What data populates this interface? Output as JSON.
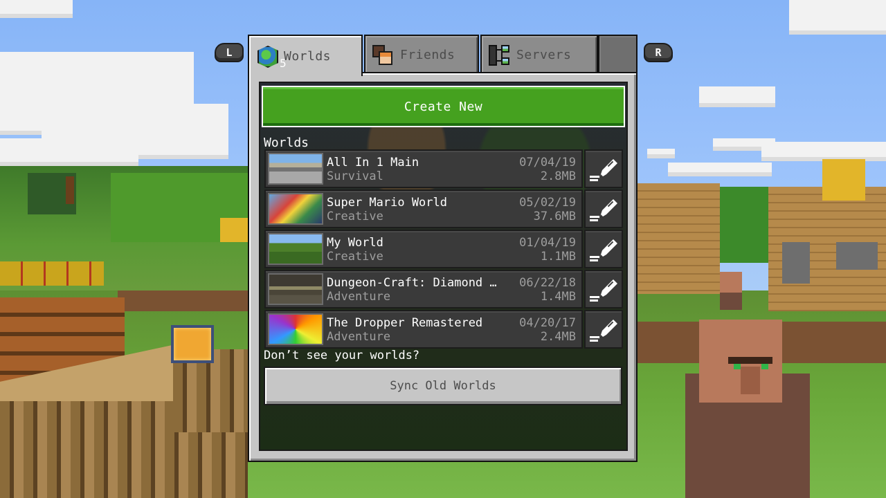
{
  "controls": {
    "left_shoulder": "L",
    "right_shoulder": "R"
  },
  "tabs": [
    {
      "label": "Worlds",
      "icon": "globe-icon",
      "badge": "5",
      "active": true
    },
    {
      "label": "Friends",
      "icon": "friends-faces-icon",
      "active": false
    },
    {
      "label": "Servers",
      "icon": "server-icon",
      "active": false
    }
  ],
  "main": {
    "create_button": "Create New",
    "section_label": "Worlds",
    "worlds": [
      {
        "name": "All In 1 Main",
        "mode": "Survival",
        "date": "07/04/19",
        "size": "2.8MB"
      },
      {
        "name": "Super Mario World",
        "mode": "Creative",
        "date": "05/02/19",
        "size": "37.6MB"
      },
      {
        "name": "My World",
        "mode": "Creative",
        "date": "01/04/19",
        "size": "1.1MB"
      },
      {
        "name": "Dungeon-Craft: Diamond …",
        "mode": "Adventure",
        "date": "06/22/18",
        "size": "1.4MB"
      },
      {
        "name": "The Dropper Remastered",
        "mode": "Adventure",
        "date": "04/20/17",
        "size": "2.4MB"
      }
    ],
    "hint": "Don’t see your worlds?",
    "sync_button": "Sync Old Worlds"
  },
  "colors": {
    "create_green": "#45a11f",
    "panel_gray": "#c6c6c6",
    "row_dark": "#3a3a3a",
    "sky_blue": "#8fb8f6"
  }
}
